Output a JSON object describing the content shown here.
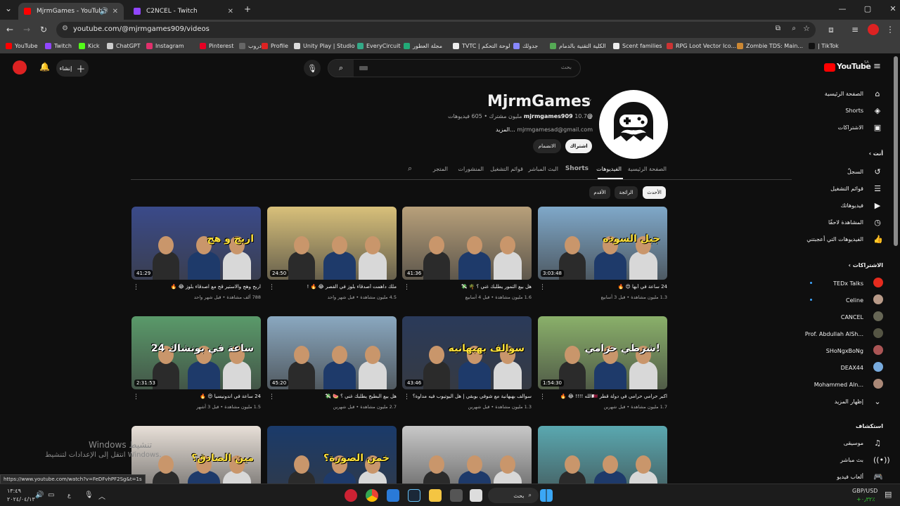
{
  "browser": {
    "tabs": [
      {
        "title": "MjrmGames - YouTube",
        "active": true
      },
      {
        "title": "C2NCEL - Twitch",
        "active": false
      }
    ],
    "new_tab_label": "+",
    "url": "youtube.com/@mjrmgames909/videos",
    "bookmarks": [
      {
        "label": "YouTube",
        "color": "#ff0000"
      },
      {
        "label": "Twitch",
        "color": "#9146ff"
      },
      {
        "label": "Kick",
        "color": "#53fc18"
      },
      {
        "label": "ChatGPT",
        "color": "#cccccc"
      },
      {
        "label": "Instagram",
        "color": "#e1306c"
      },
      {
        "label": "Pinterest",
        "color": "#e60023"
      },
      {
        "label": "دروب",
        "color": "#666666"
      },
      {
        "label": "Profile",
        "color": "#d22"
      },
      {
        "label": "Unity Play | Studio",
        "color": "#ddd"
      },
      {
        "label": "EveryCircuit",
        "color": "#3a8"
      },
      {
        "label": "مجلة العطور",
        "color": "#2a7"
      },
      {
        "label": "TVTC | لوحة التحكم",
        "color": "#eee"
      },
      {
        "label": "جدولك",
        "color": "#88f"
      },
      {
        "label": "الكلية التقنية بالدمام",
        "color": "#5a5"
      },
      {
        "label": "Scent families",
        "color": "#eee"
      },
      {
        "label": "RPG Loot Vector Ico...",
        "color": "#c33"
      },
      {
        "label": "Zombie TDS: Main...",
        "color": "#c83"
      },
      {
        "label": "| TikTok",
        "color": "#111"
      }
    ]
  },
  "yt": {
    "logo_text": "YouTube",
    "region": "SA",
    "search_placeholder": "بحث",
    "create_label": "إنشاء",
    "sidebar": {
      "main": [
        {
          "label": "الصفحة الرئيسية",
          "icon": "home-icon",
          "glyph": "⌂"
        },
        {
          "label": "Shorts",
          "icon": "shorts-icon",
          "glyph": "◈"
        },
        {
          "label": "الاشتراكات",
          "icon": "subscriptions-icon",
          "glyph": "▣"
        }
      ],
      "you_header": "أنت",
      "you": [
        {
          "label": "السجلّ",
          "icon": "history-icon",
          "glyph": "↺"
        },
        {
          "label": "قوائم التشغيل",
          "icon": "playlists-icon",
          "glyph": "☰"
        },
        {
          "label": "فيديوهاتك",
          "icon": "your-videos-icon",
          "glyph": "▶"
        },
        {
          "label": "المشاهدة لاحقًا",
          "icon": "watch-later-icon",
          "glyph": "◷"
        },
        {
          "label": "الفيديوهات التي أعجبتني",
          "icon": "liked-icon",
          "glyph": "👍"
        }
      ],
      "subs_header": "الاشتراكات",
      "subs": [
        {
          "label": "TEDx Talks",
          "color": "#e62b1e",
          "live": true
        },
        {
          "label": "Celine",
          "color": "#b89a88",
          "live": true
        },
        {
          "label": "CANCEL",
          "color": "#665",
          "live": false
        },
        {
          "label": "Prof. Abdullah AlSh...",
          "color": "#554",
          "live": false
        },
        {
          "label": "SHoNgxBoNg",
          "color": "#a55",
          "live": false
        },
        {
          "label": "DEAX44",
          "color": "#7ad",
          "live": false
        },
        {
          "label": "Mohammed Aln...",
          "color": "#a87",
          "live": false
        }
      ],
      "show_more": "إظهار المزيد",
      "explore_header": "استكشاف",
      "explore": [
        {
          "label": "موسيقى",
          "icon": "music-icon",
          "glyph": "♫"
        },
        {
          "label": "بث مباشر",
          "icon": "live-icon",
          "glyph": "((•))"
        },
        {
          "label": "ألعاب فيديو",
          "icon": "gaming-icon",
          "glyph": "🎮"
        }
      ]
    },
    "channel": {
      "name": "MjrmGames",
      "verified": "✓",
      "handle": "@mjrmgames909",
      "stats": "10.7 مليون مشترك • 605 فيديوهات",
      "email": "mjrmgamesad@gmail.com",
      "more": "...المزيد",
      "subscribe_label": "اشتراك",
      "join_label": "الانضمام"
    },
    "channel_tabs": [
      "الصفحة الرئيسية",
      "الفيديوهات",
      "Shorts",
      "البث المباشر",
      "قوائم التشغيل",
      "المنشورات",
      "المتجر"
    ],
    "active_tab": "الفيديوهات",
    "chips": [
      "الأحدث",
      "الرائجة",
      "الأقدم"
    ],
    "videos": [
      {
        "title": "24 ساعة في أبها 😍 🔥",
        "meta": "1.3 مليون مشاهدة • قبل 3 أسابيع",
        "duration": "3:03:48",
        "bg": "#7fa8c9",
        "art": "جبل السوده"
      },
      {
        "title": "هل بيع التمور يطلبك غني ؟ 🌴 💸",
        "meta": "1.6 مليون مشاهدة • قبل 4 أسابيع",
        "duration": "41:36",
        "bg": "#b8a07a",
        "art": ""
      },
      {
        "title": "ملك داهمت أصدقاء بلوز في القصر 😂 🔥 !",
        "meta": "4.5 مليون مشاهدة • قبل شهر واحد",
        "duration": "24:50",
        "bg": "#d8c07a",
        "art": ""
      },
      {
        "title": "اربح وهج والاستير قح مع اصدقاء بلوز 😂 🔥",
        "meta": "788 ألف مشاهدة • قبل شهر واحد",
        "duration": "41:29",
        "bg": "#3a4a8a",
        "art": "اربح و هج"
      },
      {
        "title": "اكبر حرامي حرامي في دولة قطر 🇶🇦الله !!!! 😂 🔥",
        "meta": "1.7 مليون مشاهدة • قبل شهرين",
        "duration": "1:54:30",
        "bg": "#8ab06a",
        "art": "شرطي حرامي!"
      },
      {
        "title": "سوالف بهبهانية مع شوفي بوبقي | هل اليوتيوب فيه مداوة؟",
        "meta": "1.3 مليون مشاهدة • قبل شهرين",
        "duration": "43:46",
        "bg": "#2a3a5a",
        "art": "سوالف بهبهانيه"
      },
      {
        "title": "هل بيع البطيخ يطلبك غني ؟ 🍉 💸",
        "meta": "2.7 مليون مشاهدة • قبل شهرين",
        "duration": "45:20",
        "bg": "#8aa8c0",
        "art": ""
      },
      {
        "title": "24 ساعة في اندونيسيا 😍 🔥",
        "meta": "1.5 مليون مشاهدة • قبل 3 أشهر",
        "duration": "2:31:53",
        "bg": "#5a9a6a",
        "art": "24 ساعة في بونشاك"
      },
      {
        "title": "",
        "meta": "",
        "duration": "",
        "bg": "#5aa8b0",
        "art": ""
      },
      {
        "title": "",
        "meta": "",
        "duration": "",
        "bg": "#c8c8c8",
        "art": ""
      },
      {
        "title": "",
        "meta": "",
        "duration": "",
        "bg": "#1a3a6a",
        "art": "خمن الصورة؟"
      },
      {
        "title": "",
        "meta": "",
        "duration": "",
        "bg": "#e8e0d8",
        "art": "مين الصادق؟"
      }
    ]
  },
  "overlay": {
    "watermark_line1": "Windows تنشيط",
    "watermark_line2": "انتقل إلى الإعدادات لتنشيط Windows.",
    "status_url": "https://www.youtube.com/watch?v=FeDFvhPF2Sg&t=1s"
  },
  "taskbar": {
    "search_label": "بحث",
    "time": "١٣:٤٩",
    "date": "٢٠٢٤/٠٤/١٣",
    "currency": "GBP/USD",
    "currency_change": "+٠٫٣٢٪",
    "lang": "ع"
  }
}
